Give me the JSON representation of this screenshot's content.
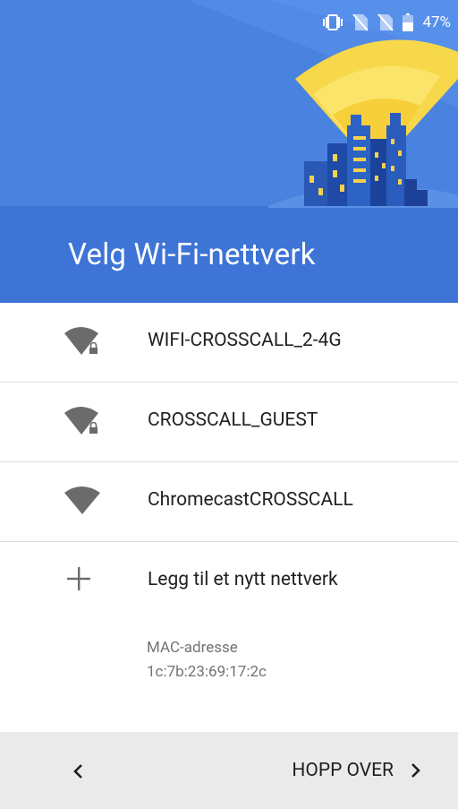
{
  "status_bar": {
    "battery_percent": "47%",
    "icons": [
      "vibrate-icon",
      "no-sim-icon",
      "no-sim-icon",
      "battery-icon"
    ]
  },
  "header": {
    "title": "Velg Wi-Fi-nettverk",
    "illustration": "wifi-city-illustration",
    "color": "#4a82e0"
  },
  "networks": [
    {
      "name": "WIFI-CROSSCALL_2-4G",
      "secured": true,
      "icon": "wifi-lock-icon"
    },
    {
      "name": "CROSSCALL_GUEST",
      "secured": true,
      "icon": "wifi-lock-icon"
    },
    {
      "name": "ChromecastCROSSCALL",
      "secured": false,
      "icon": "wifi-icon"
    }
  ],
  "add_network": {
    "label": "Legg til et nytt nettverk",
    "icon": "plus-icon"
  },
  "mac": {
    "label": "MAC-adresse",
    "value": "1c:7b:23:69:17:2c"
  },
  "bottom_bar": {
    "skip_label": "HOPP OVER",
    "back_icon": "chevron-left-icon",
    "forward_icon": "chevron-right-icon"
  }
}
